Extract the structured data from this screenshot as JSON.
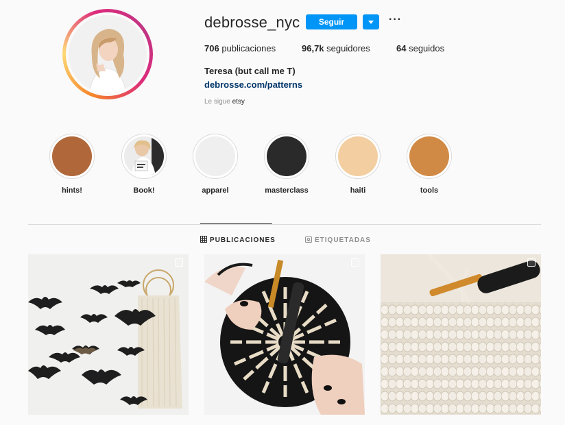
{
  "profile": {
    "username": "debrosse_nyc",
    "follow_label": "Seguir",
    "more_label": "···",
    "stats": {
      "posts_count": "706",
      "posts_label": "publicaciones",
      "followers_count": "96,7k",
      "followers_label": "seguidores",
      "following_count": "64",
      "following_label": "seguidos"
    },
    "full_name": "Teresa (but call me T)",
    "website": "debrosse.com/patterns",
    "followed_by_prefix": "Le sigue",
    "followed_by_user": "etsy"
  },
  "highlights": [
    {
      "label": "hints!",
      "color": "#b0683a"
    },
    {
      "label": "Book!",
      "color": "#e8e8e8"
    },
    {
      "label": "apparel",
      "color": "#efefef"
    },
    {
      "label": "masterclass",
      "color": "#2a2a2a"
    },
    {
      "label": "haiti",
      "color": "#f3cea0"
    },
    {
      "label": "tools",
      "color": "#d08a45"
    }
  ],
  "tabs": {
    "posts": "PUBLICACIONES",
    "tagged": "ETIQUETADAS"
  },
  "colors": {
    "accent": "#0095f6",
    "link": "#00376b"
  }
}
